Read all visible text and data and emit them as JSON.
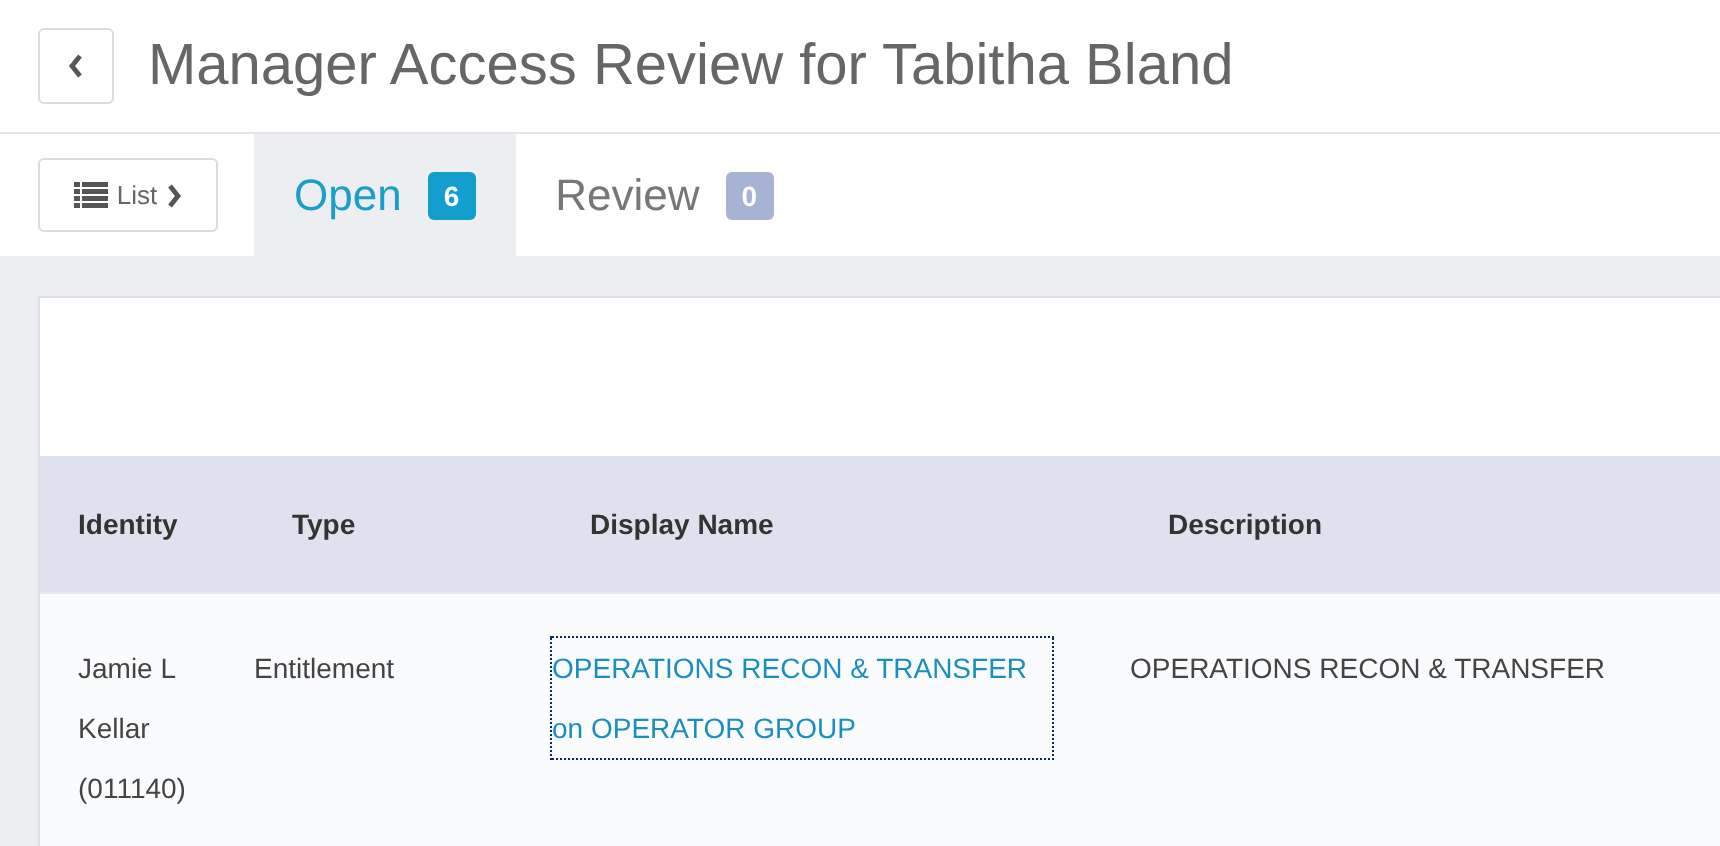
{
  "title": "Manager Access Review for Tabitha Bland",
  "list_button": "List",
  "tabs": [
    {
      "label": "Open",
      "count": "6",
      "selected": true
    },
    {
      "label": "Review",
      "count": "0",
      "selected": false
    }
  ],
  "table": {
    "columns": [
      "Identity",
      "Type",
      "Display Name",
      "Description"
    ],
    "rows": [
      {
        "identity": "Jamie L Kellar (011140)",
        "type": "Entitlement",
        "display_name": "OPERATIONS RECON & TRANSFER on OPERATOR GROUP",
        "description": "OPERATIONS RECON & TRANSFER"
      }
    ]
  }
}
